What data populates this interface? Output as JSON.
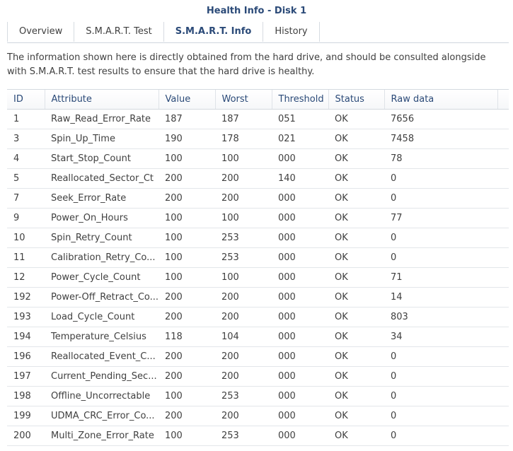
{
  "window": {
    "title": "Health Info - Disk 1"
  },
  "tabs": [
    {
      "label": "Overview",
      "active": false
    },
    {
      "label": "S.M.A.R.T. Test",
      "active": false
    },
    {
      "label": "S.M.A.R.T. Info",
      "active": true
    },
    {
      "label": "History",
      "active": false
    }
  ],
  "description": "The information shown here is directly obtained from the hard drive, and should be consulted alongside with S.M.A.R.T. test results to ensure that the hard drive is healthy.",
  "table": {
    "columns": [
      "ID",
      "Attribute",
      "Value",
      "Worst",
      "Threshold",
      "Status",
      "Raw data"
    ],
    "rows": [
      [
        "1",
        "Raw_Read_Error_Rate",
        "187",
        "187",
        "051",
        "OK",
        "7656"
      ],
      [
        "3",
        "Spin_Up_Time",
        "190",
        "178",
        "021",
        "OK",
        "7458"
      ],
      [
        "4",
        "Start_Stop_Count",
        "100",
        "100",
        "000",
        "OK",
        "78"
      ],
      [
        "5",
        "Reallocated_Sector_Ct",
        "200",
        "200",
        "140",
        "OK",
        "0"
      ],
      [
        "7",
        "Seek_Error_Rate",
        "200",
        "200",
        "000",
        "OK",
        "0"
      ],
      [
        "9",
        "Power_On_Hours",
        "100",
        "100",
        "000",
        "OK",
        "77"
      ],
      [
        "10",
        "Spin_Retry_Count",
        "100",
        "253",
        "000",
        "OK",
        "0"
      ],
      [
        "11",
        "Calibration_Retry_Co...",
        "100",
        "253",
        "000",
        "OK",
        "0"
      ],
      [
        "12",
        "Power_Cycle_Count",
        "100",
        "100",
        "000",
        "OK",
        "71"
      ],
      [
        "192",
        "Power-Off_Retract_Co...",
        "200",
        "200",
        "000",
        "OK",
        "14"
      ],
      [
        "193",
        "Load_Cycle_Count",
        "200",
        "200",
        "000",
        "OK",
        "803"
      ],
      [
        "194",
        "Temperature_Celsius",
        "118",
        "104",
        "000",
        "OK",
        "34"
      ],
      [
        "196",
        "Reallocated_Event_C...",
        "200",
        "200",
        "000",
        "OK",
        "0"
      ],
      [
        "197",
        "Current_Pending_Sec...",
        "200",
        "200",
        "000",
        "OK",
        "0"
      ],
      [
        "198",
        "Offline_Uncorrectable",
        "100",
        "253",
        "000",
        "OK",
        "0"
      ],
      [
        "199",
        "UDMA_CRC_Error_Co...",
        "200",
        "200",
        "000",
        "OK",
        "0"
      ],
      [
        "200",
        "Multi_Zone_Error_Rate",
        "100",
        "253",
        "000",
        "OK",
        "0"
      ]
    ]
  }
}
